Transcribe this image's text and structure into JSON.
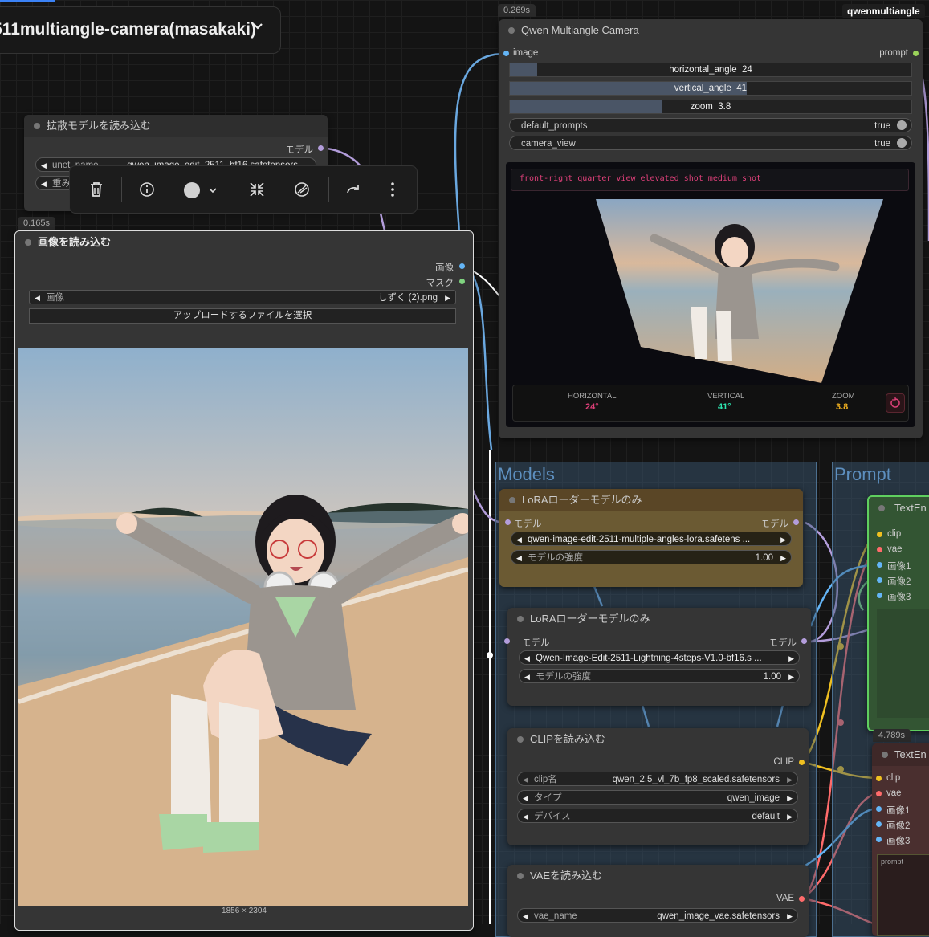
{
  "workflow_selector": {
    "label": "511multiangle-camera(masakaki)"
  },
  "toolbar": {
    "icons": [
      "trash-icon",
      "info-icon",
      "color-circle-icon",
      "chevron-down-icon",
      "collapse-icon",
      "bypass-icon",
      "redo-icon",
      "more-icon"
    ]
  },
  "diffusion_node": {
    "title": "拡散モデルを読み込む",
    "output": "モデル",
    "w1_label": "unet_name",
    "w1_value": "qwen_image_edit_2511_bf16.safetensors",
    "w2_label": "重み"
  },
  "load_image_node": {
    "timing": "0.165s",
    "title": "画像を読み込む",
    "output_image": "画像",
    "output_mask": "マスク",
    "image_label": "画像",
    "image_value": "しずく (2).png",
    "upload_label": "アップロードするファイルを選択",
    "dimensions": "1856 × 2304"
  },
  "camera_node": {
    "timing": "0.269s",
    "badge": "qwenmultiangle",
    "title": "Qwen Multiangle Camera",
    "input_image": "image",
    "output_prompt": "prompt",
    "horizontal_label": "horizontal_angle",
    "horizontal_value": "24",
    "horizontal_fill": 0.067,
    "vertical_label": "vertical_angle",
    "vertical_value": "41",
    "vertical_fill": 0.59,
    "zoom_label": "zoom",
    "zoom_value": "3.8",
    "zoom_fill": 0.38,
    "default_prompts_label": "default_prompts",
    "default_prompts_value": "true",
    "camera_view_label": "camera_view",
    "camera_view_value": "true",
    "prompt_text": "front-right quarter view elevated shot medium shot",
    "stat_h_label": "HORIZONTAL",
    "stat_h_value": "24°",
    "stat_v_label": "VERTICAL",
    "stat_v_value": "41°",
    "stat_z_label": "ZOOM",
    "stat_z_value": "3.8"
  },
  "groups": {
    "models": "Models",
    "prompt": "Prompt"
  },
  "lora1": {
    "title": "LoRAローダーモデルのみ",
    "input": "モデル",
    "output": "モデル",
    "name": "qwen-image-edit-2511-multiple-angles-lora.safetens ...",
    "strength_label": "モデルの強度",
    "strength_value": "1.00"
  },
  "lora2": {
    "title": "LoRAローダーモデルのみ",
    "input": "モデル",
    "output": "モデル",
    "name": "Qwen-Image-Edit-2511-Lightning-4steps-V1.0-bf16.s ...",
    "strength_label": "モデルの強度",
    "strength_value": "1.00"
  },
  "clip_node": {
    "title": "CLIPを読み込む",
    "output": "CLIP",
    "clip_label": "clip名",
    "clip_value": "qwen_2.5_vl_7b_fp8_scaled.safetensors",
    "type_label": "タイプ",
    "type_value": "qwen_image",
    "device_label": "デバイス",
    "device_value": "default"
  },
  "vae_node": {
    "title": "VAEを読み込む",
    "output": "VAE",
    "vae_label": "vae_name",
    "vae_value": "qwen_image_vae.safetensors"
  },
  "text_enc1": {
    "title": "TextEn",
    "inputs": [
      "clip",
      "vae",
      "画像1",
      "画像2",
      "画像3"
    ]
  },
  "text_enc2": {
    "timing": "4.789s",
    "title": "TextEn",
    "inputs": [
      "clip",
      "vae",
      "画像1",
      "画像2",
      "画像3"
    ],
    "prompt_placeholder": "prompt"
  },
  "colors": {
    "clip": "#f0c020",
    "vae": "#ff6b6b",
    "image": "#64b5f6",
    "model": "#b39ddb",
    "accent": "#e0407a"
  }
}
